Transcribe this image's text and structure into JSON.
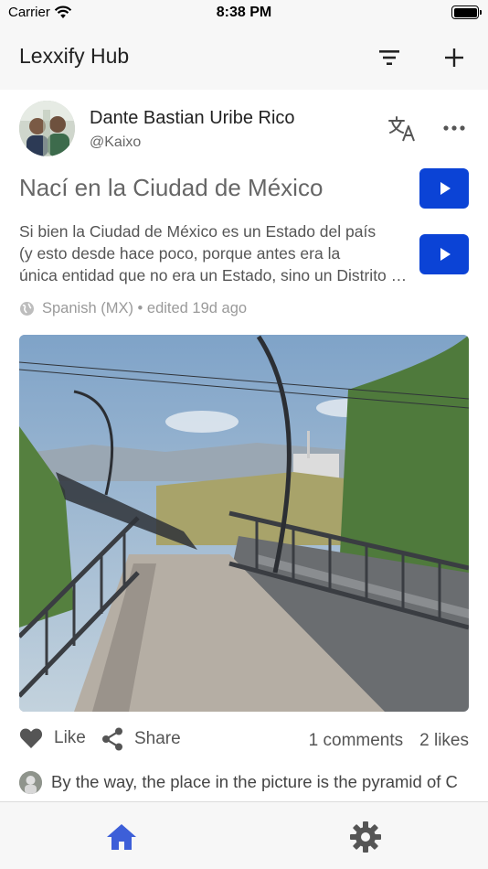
{
  "status_bar": {
    "carrier": "Carrier",
    "time": "8:38 PM"
  },
  "header": {
    "title": "Lexxify Hub",
    "icons": [
      "filter-icon",
      "plus-icon"
    ]
  },
  "post": {
    "author_name": "Dante Bastian Uribe Rico",
    "author_handle": "@Kaixo",
    "title": "Nací en la Ciudad de México",
    "body_lines": [
      "Si bien la Ciudad de México es un Estado del país",
      "(y esto desde hace poco, porque antes era la",
      "única entidad que no era un Estado, sino un Distrito Federal"
    ],
    "meta": "Spanish (MX) • edited 19d ago",
    "like_label": "Like",
    "share_label": "Share",
    "comments_count": "1 comments",
    "likes_count": "2 likes",
    "comment_preview": "By the way, the place in the picture is the pyramid of C"
  },
  "tabs": [
    {
      "name": "home",
      "icon": "home-icon",
      "active": true
    },
    {
      "name": "settings",
      "icon": "gear-icon",
      "active": false
    }
  ],
  "colors": {
    "accent": "#0b43d6",
    "tab_active": "#3d5fd8",
    "tab_inactive": "#555555",
    "muted_text": "#9a9a9a",
    "bar_background": "#f7f7f7"
  }
}
